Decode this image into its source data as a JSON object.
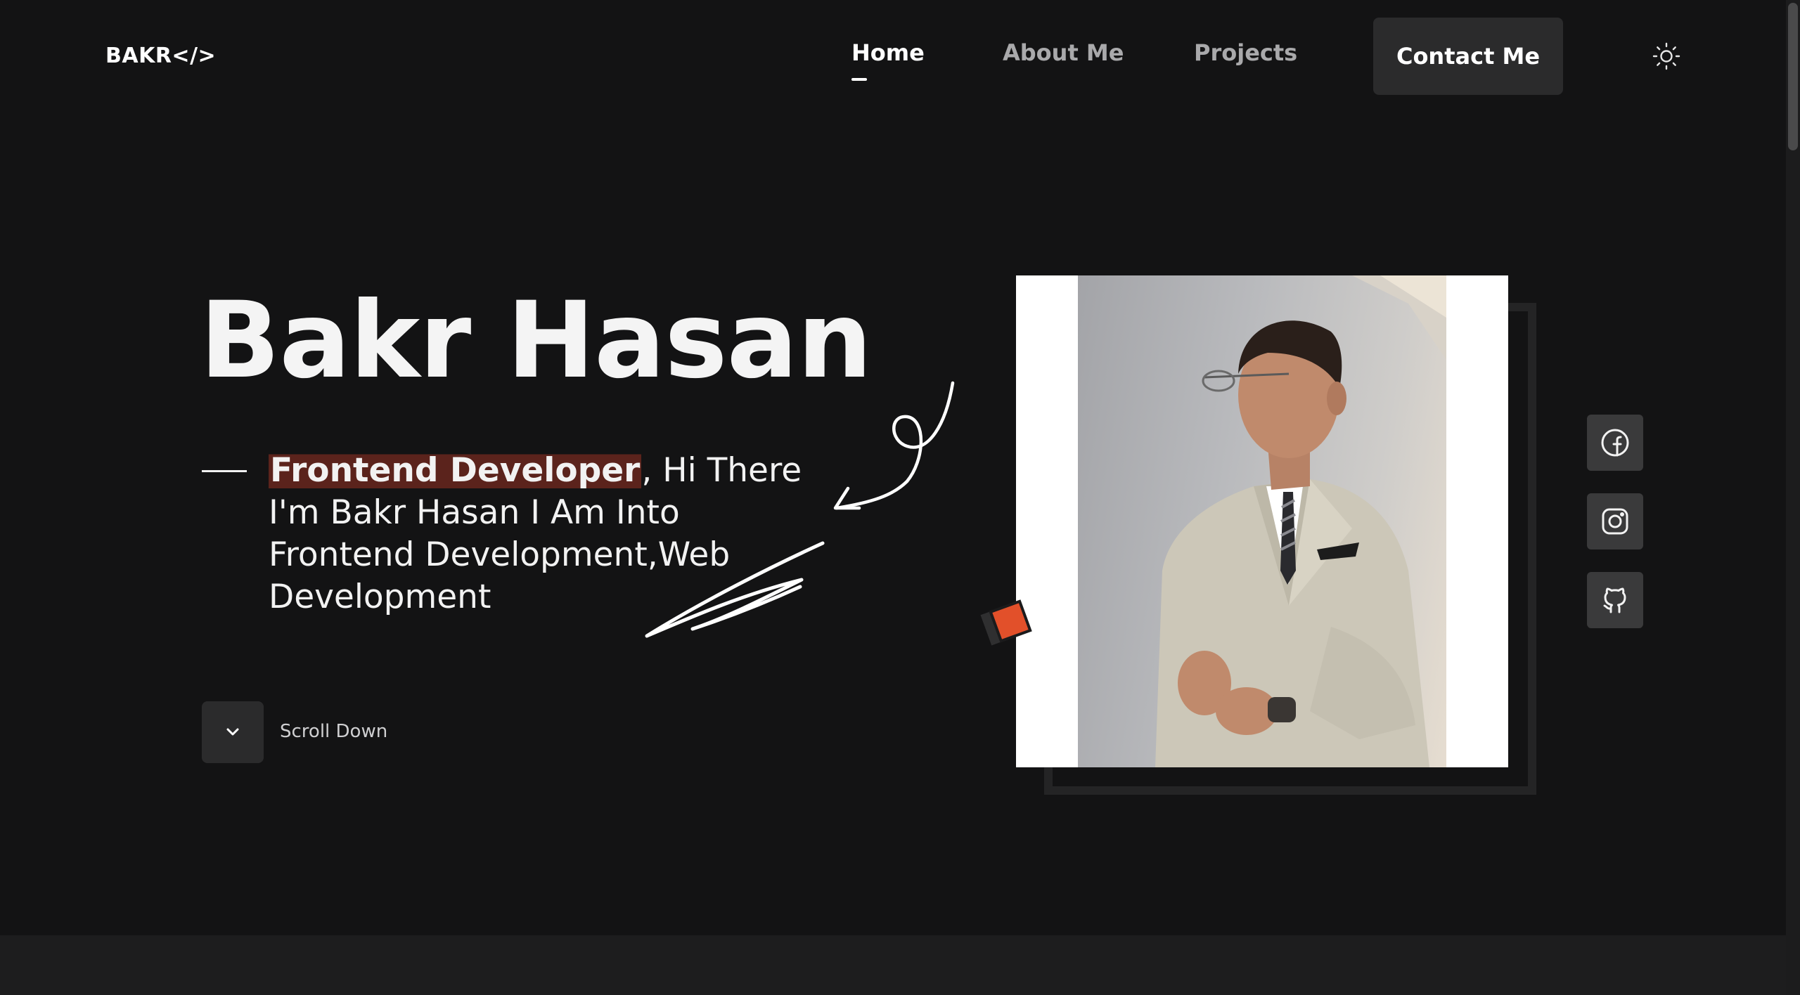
{
  "header": {
    "logo": "BAKR</>",
    "nav": [
      {
        "label": "Home",
        "active": true
      },
      {
        "label": "About Me",
        "active": false
      },
      {
        "label": "Projects",
        "active": false
      }
    ],
    "contact_label": "Contact Me",
    "theme_icon": "sun-icon"
  },
  "hero": {
    "name": "Bakr Hasan",
    "role": "Frontend Developer",
    "intro": ", Hi There I'm Bakr Hasan I Am Into Frontend Development,Web Development",
    "scroll_label": "Scroll Down",
    "scroll_icon": "chevron-down-icon"
  },
  "social": [
    {
      "name": "facebook-icon"
    },
    {
      "name": "instagram-icon"
    },
    {
      "name": "github-icon"
    }
  ],
  "colors": {
    "background": "#131314",
    "surface": "#2b2b2c",
    "accent": "#e2502a",
    "highlight": "#5b231c"
  }
}
